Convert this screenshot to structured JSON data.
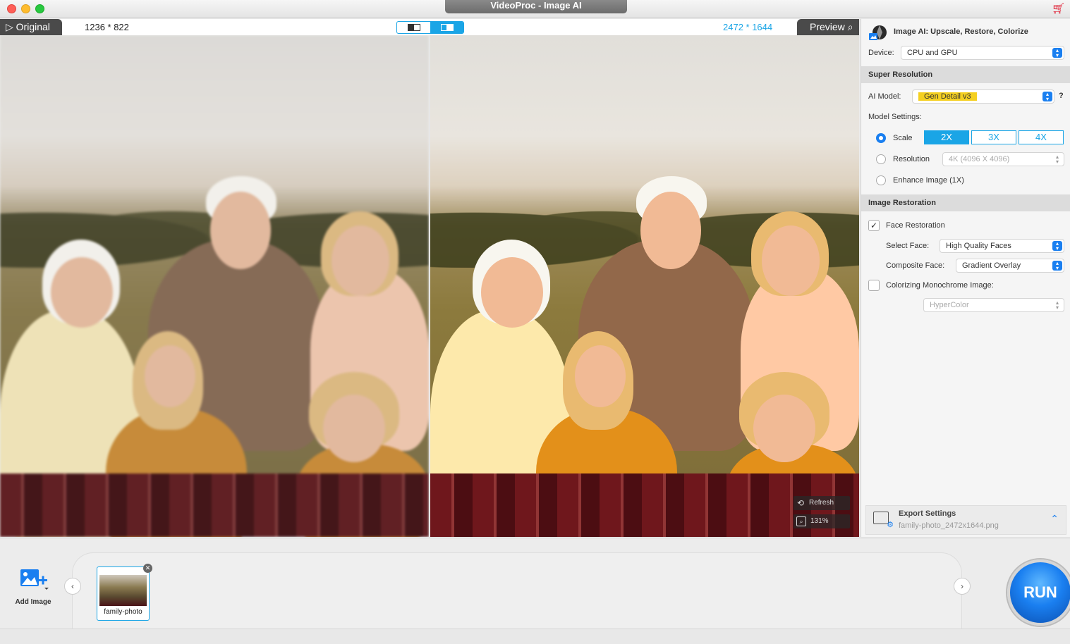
{
  "window": {
    "title": "VideoProc - Image AI"
  },
  "viewer": {
    "original_label": "Original",
    "original_dims": "1236 * 822",
    "preview_label": "Preview",
    "preview_dims": "2472 * 1644",
    "refresh_label": "Refresh",
    "zoom_label": "131%"
  },
  "panel": {
    "title": "Image AI: Upscale, Restore, Colorize",
    "device_label": "Device:",
    "device_value": "CPU and GPU",
    "super_resolution": {
      "header": "Super Resolution",
      "ai_model_label": "AI Model:",
      "ai_model_value": "Gen Detail v3",
      "help": "?",
      "model_settings_label": "Model Settings:",
      "scale_label": "Scale",
      "scale_options": [
        "2X",
        "3X",
        "4X"
      ],
      "scale_selected": "2X",
      "resolution_label": "Resolution",
      "resolution_value": "4K (4096 X 4096)",
      "enhance_label": "Enhance Image (1X)"
    },
    "restoration": {
      "header": "Image Restoration",
      "face_restoration_label": "Face Restoration",
      "face_restoration_checked": true,
      "select_face_label": "Select Face:",
      "select_face_value": "High Quality Faces",
      "composite_face_label": "Composite Face:",
      "composite_face_value": "Gradient Overlay",
      "colorizing_label": "Colorizing Monochrome Image:",
      "colorizing_checked": false,
      "colorizing_value": "HyperColor"
    },
    "export": {
      "title": "Export Settings",
      "filename": "family-photo_2472x1644.png"
    }
  },
  "bottom": {
    "add_image_label": "Add Image",
    "thumbnail_label": "family-photo",
    "run_label": "RUN"
  },
  "colors": {
    "accent": "#1aa5e6",
    "select_blue": "#1a7ff0",
    "highlight": "#f5d020",
    "run": "#1a7ff0"
  }
}
